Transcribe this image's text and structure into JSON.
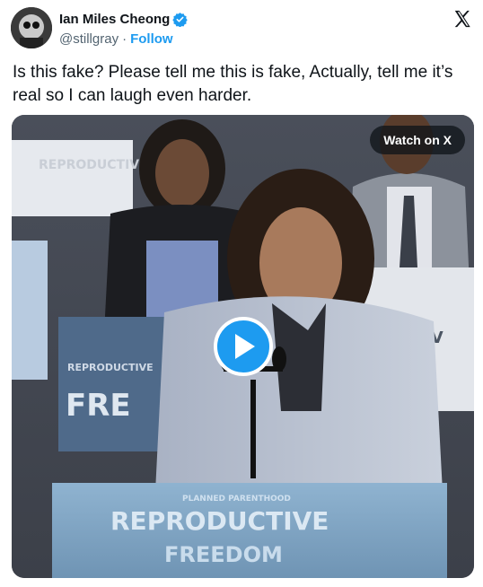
{
  "author": {
    "display_name": "Ian Miles Cheong",
    "handle": "@stillgray",
    "separator": "·",
    "follow_label": "Follow",
    "verified_icon": "verified-badge-icon",
    "brand_color": "#1d9bf0"
  },
  "platform": {
    "logo_icon": "x-logo-icon"
  },
  "tweet": {
    "text": "Is this fake? Please tell me this is fake, Actually, tell me it’s real so I can laugh even harder."
  },
  "media": {
    "watch_label": "Watch on X",
    "play_icon": "play-icon",
    "sign_top_left": "REPRODUCTIVE",
    "sign_left": "FRE",
    "sign_left_small": "REPRODUCTIVE",
    "sign_right": "UCTIV",
    "podium_small": "PLANNED PARENTHOOD",
    "podium_main": "REPRODUCTIVE",
    "podium_bottom": "FREEDOM"
  }
}
